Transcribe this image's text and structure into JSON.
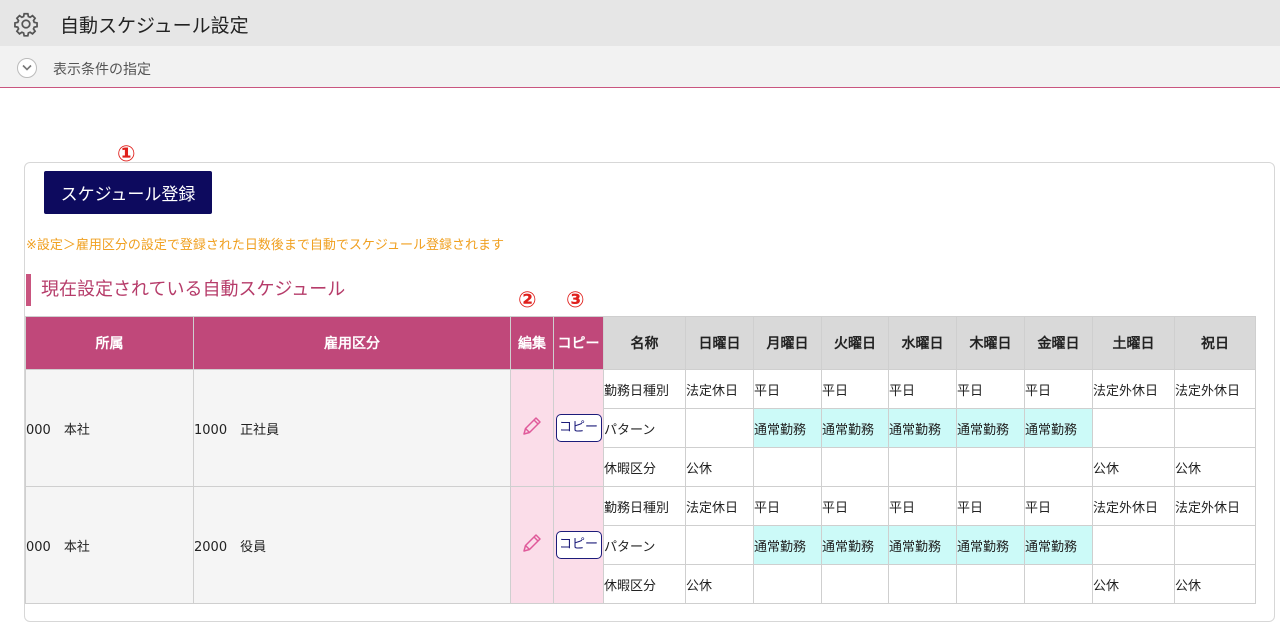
{
  "header": {
    "title": "自動スケジュール設定",
    "icon": "gear-icon"
  },
  "condition": {
    "label": "表示条件の指定",
    "icon": "chevron-down-icon"
  },
  "markers": [
    "①",
    "②",
    "③"
  ],
  "register_button": "スケジュール登録",
  "notice": "※設定＞雇用区分の設定で登録された日数後まで自動でスケジュール登録されます",
  "section_title": "現在設定されている自動スケジュール",
  "table": {
    "headers": {
      "dept": "所属",
      "emp": "雇用区分",
      "edit": "編集",
      "copy": "コピー",
      "name": "名称",
      "sun": "日曜日",
      "mon": "月曜日",
      "tue": "火曜日",
      "wed": "水曜日",
      "thu": "木曜日",
      "fri": "金曜日",
      "sat": "土曜日",
      "hol": "祝日"
    },
    "copy_label": "コピー",
    "rows": [
      {
        "dept": "000　本社",
        "emp": "1000　正社員",
        "sub": [
          {
            "name": "勤務日種別",
            "cells": [
              "法定休日",
              "平日",
              "平日",
              "平日",
              "平日",
              "平日",
              "法定外休日",
              "法定外休日"
            ]
          },
          {
            "name": "パターン",
            "cells": [
              "",
              "通常勤務",
              "通常勤務",
              "通常勤務",
              "通常勤務",
              "通常勤務",
              "",
              ""
            ]
          },
          {
            "name": "休暇区分",
            "cells": [
              "公休",
              "",
              "",
              "",
              "",
              "",
              "公休",
              "公休"
            ]
          }
        ]
      },
      {
        "dept": "000　本社",
        "emp": "2000　役員",
        "sub": [
          {
            "name": "勤務日種別",
            "cells": [
              "法定休日",
              "平日",
              "平日",
              "平日",
              "平日",
              "平日",
              "法定外休日",
              "法定外休日"
            ]
          },
          {
            "name": "パターン",
            "cells": [
              "",
              "通常勤務",
              "通常勤務",
              "通常勤務",
              "通常勤務",
              "通常勤務",
              "",
              ""
            ]
          },
          {
            "name": "休暇区分",
            "cells": [
              "公休",
              "",
              "",
              "",
              "",
              "",
              "公休",
              "公休"
            ]
          }
        ]
      }
    ]
  },
  "colors": {
    "accent": "#c0487a",
    "button": "#0d0a5e",
    "notice": "#f0a020",
    "marker": "#e0201c",
    "pattern": "#ccfaf8"
  }
}
